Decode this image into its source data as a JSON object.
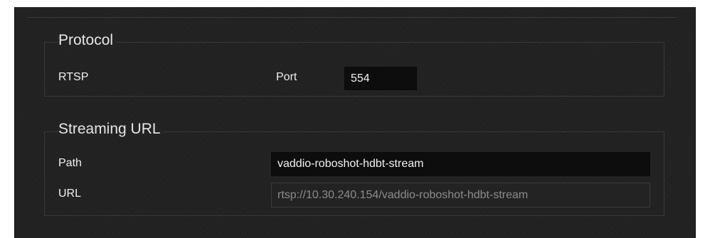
{
  "protocol": {
    "legend": "Protocol",
    "rtsp_label": "RTSP",
    "port_label": "Port",
    "port_value": "554"
  },
  "streaming_url": {
    "legend": "Streaming URL",
    "path_label": "Path",
    "path_value": "vaddio-roboshot-hdbt-stream",
    "url_label": "URL",
    "url_value": "rtsp://10.30.240.154/vaddio-roboshot-hdbt-stream"
  }
}
